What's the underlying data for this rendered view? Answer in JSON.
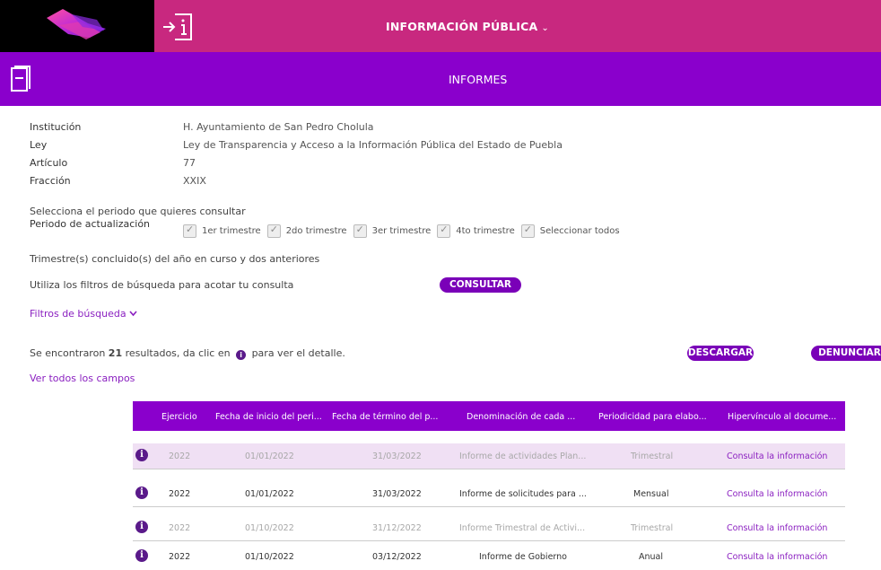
{
  "header": {
    "title": "INFORMACIÓN PÚBLICA",
    "title_chevron": "⌄",
    "bg_color": "#c8287f"
  },
  "section": {
    "title": "INFORMES",
    "bg_color": "#8a00cc"
  },
  "info": {
    "institucion_label": "Institución",
    "institucion_value": "H. Ayuntamiento de San Pedro Cholula",
    "ley_label": "Ley",
    "ley_value": "Ley de Transparencia y Acceso a la Información Pública del Estado de Puebla",
    "articulo_label": "Artículo",
    "articulo_value": "77",
    "fraccion_label": "Fracción",
    "fraccion_value": "XXIX"
  },
  "period": {
    "prompt": "Selecciona el periodo que quieres consultar",
    "label": "Periodo de actualización",
    "options": [
      "1er trimestre",
      "2do trimestre",
      "3er trimestre",
      "4to trimestre",
      "Seleccionar todos"
    ]
  },
  "trimester_note": "Trimestre(s) concluido(s) del año en curso y dos anteriores",
  "filters_note": "Utiliza los filtros de búsqueda para acotar tu consulta",
  "consultar_label": "CONSULTAR",
  "filtros_link": "Filtros de búsqueda",
  "results": {
    "prefix": "Se encontraron ",
    "count": "21",
    "middle": " resultados, da clic en ",
    "suffix": " para ver el detalle."
  },
  "descargar_label": "DESCARGAR",
  "denunciar_label": "DENUNCIAR",
  "ver_todos_link": "Ver todos los campos",
  "table": {
    "headers": [
      "Ejercicio",
      "Fecha de inicio del peri...",
      "Fecha de término del p...",
      "Denominación de cada ...",
      "Periodicidad para elabo...",
      "Hipervínculo al docume..."
    ],
    "rows": [
      [
        "2022",
        "01/01/2022",
        "31/03/2022",
        "Informe de actividades Plan...",
        "Trimestral",
        "Consulta la información"
      ],
      [
        "2022",
        "01/01/2022",
        "31/03/2022",
        "Informe de solicitudes para ...",
        "Mensual",
        "Consulta la información"
      ],
      [
        "2022",
        "01/10/2022",
        "31/12/2022",
        "Informe Trimestral de Activi...",
        "Trimestral",
        "Consulta la información"
      ],
      [
        "2022",
        "01/10/2022",
        "03/12/2022",
        "Informe de Gobierno",
        "Anual",
        "Consulta la información"
      ]
    ]
  },
  "accent_color": "#7a00b8",
  "link_color": "#8a1fc0",
  "info_icon_glyph": "i"
}
